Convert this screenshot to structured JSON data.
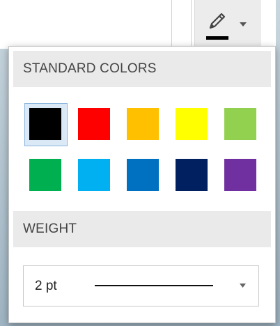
{
  "toolbar": {
    "pen_button": {
      "icon": "pen-icon",
      "current_color": "#000000"
    }
  },
  "popup": {
    "standard_colors_header": "STANDARD COLORS",
    "weight_header": "WEIGHT",
    "swatches": [
      {
        "name": "black",
        "color": "#000000",
        "selected": true
      },
      {
        "name": "red",
        "color": "#ff0000",
        "selected": false
      },
      {
        "name": "orange",
        "color": "#ffc000",
        "selected": false
      },
      {
        "name": "yellow",
        "color": "#ffff00",
        "selected": false
      },
      {
        "name": "light-green",
        "color": "#92d050",
        "selected": false
      },
      {
        "name": "green",
        "color": "#00b050",
        "selected": false
      },
      {
        "name": "light-blue",
        "color": "#00b0f0",
        "selected": false
      },
      {
        "name": "blue",
        "color": "#0070c0",
        "selected": false
      },
      {
        "name": "dark-blue",
        "color": "#002060",
        "selected": false
      },
      {
        "name": "purple",
        "color": "#7030a0",
        "selected": false
      }
    ],
    "weight": {
      "selected_label": "2 pt"
    }
  }
}
